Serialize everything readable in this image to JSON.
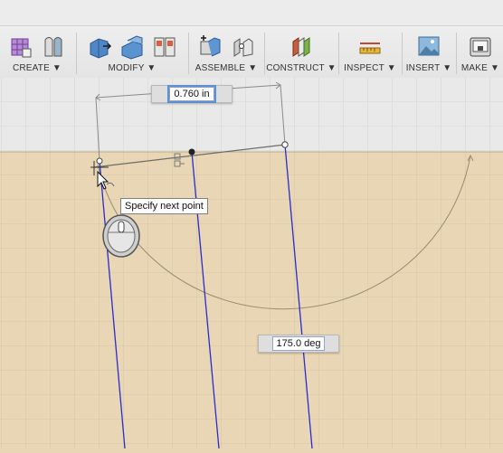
{
  "toolbar": {
    "groups": [
      {
        "label": "CREATE ▼"
      },
      {
        "label": "MODIFY ▼"
      },
      {
        "label": "ASSEMBLE ▼"
      },
      {
        "label": "CONSTRUCT ▼"
      },
      {
        "label": "INSPECT ▼"
      },
      {
        "label": "INSERT ▼"
      },
      {
        "label": "MAKE ▼"
      }
    ]
  },
  "sketch": {
    "length_dimension": "0.760 in",
    "angle_dimension": "175.0 deg",
    "tooltip": "Specify next point"
  },
  "colors": {
    "canvas_background": "#e8d6b4",
    "grid_background": "#e9e9e9",
    "sketch_line": "#2b2bd0",
    "dimension_line": "#8a8a8a"
  }
}
